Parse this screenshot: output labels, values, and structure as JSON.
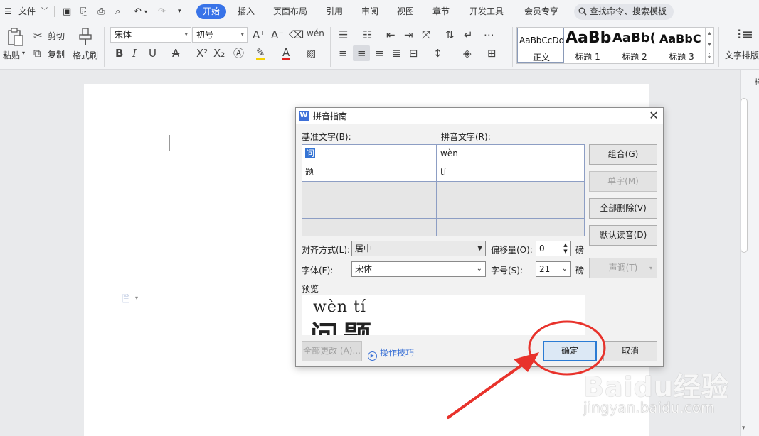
{
  "menubar": {
    "file": "文件",
    "tabs": [
      "开始",
      "插入",
      "页面布局",
      "引用",
      "审阅",
      "视图",
      "章节",
      "开发工具",
      "会员专享"
    ],
    "search_placeholder": "查找命令、搜索模板"
  },
  "ribbon": {
    "paste": "粘贴",
    "cut": "剪切",
    "copy": "复制",
    "format_painter": "格式刷",
    "font_name": "宋体",
    "font_size": "初号",
    "styles": [
      {
        "sample": "AaBbCcDd",
        "name": "正文"
      },
      {
        "sample": "AaBb",
        "name": "标题 1"
      },
      {
        "sample": "AaBb(",
        "name": "标题 2"
      },
      {
        "sample": "AaBbC",
        "name": "标题 3"
      }
    ],
    "text_layout": "文字排版"
  },
  "dialog": {
    "title": "拼音指南",
    "base_text_label": "基准文字(B):",
    "ruby_text_label": "拼音文字(R):",
    "rows": [
      {
        "base": "问",
        "ruby": "wèn"
      },
      {
        "base": "题",
        "ruby": "tí"
      },
      {
        "base": "",
        "ruby": ""
      },
      {
        "base": "",
        "ruby": ""
      },
      {
        "base": "",
        "ruby": ""
      }
    ],
    "buttons": {
      "group": "组合(G)",
      "single": "单字(M)",
      "clear_all": "全部删除(V)",
      "default_reading": "默认读音(D)",
      "tone": "声调(T)",
      "change_all": "全部更改 (A)...",
      "ok": "确定",
      "cancel": "取消"
    },
    "alignment_label": "对齐方式(L):",
    "alignment_value": "居中",
    "offset_label": "偏移量(O):",
    "offset_value": "0",
    "unit": "磅",
    "font_label": "字体(F):",
    "font_value": "宋体",
    "size_label": "字号(S):",
    "size_value": "21",
    "preview_label": "预览",
    "preview_pinyin": "wèn  tí",
    "preview_hanzi": "问题",
    "tips": "操作技巧"
  },
  "watermark": {
    "logo": "Baidu经验",
    "url": "jingyan.baidu.com"
  },
  "colors": {
    "accent": "#3873e8",
    "annotation_red": "#e8322b",
    "ok_border": "#2b7bd4"
  }
}
